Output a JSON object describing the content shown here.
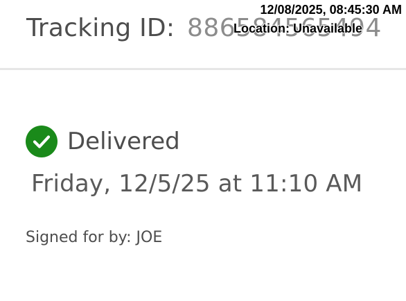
{
  "header": {
    "tracking_label": "Tracking ID:",
    "tracking_number": "886584565494"
  },
  "overlay": {
    "timestamp": "12/08/2025, 08:45:30 AM",
    "location": "Location: Unavailable"
  },
  "status": {
    "icon": "check-circle-icon",
    "icon_color": "#1a8a1a",
    "label": "Delivered",
    "date_time": "Friday, 12/5/25 at 11:10 AM",
    "signed_by": "Signed for by: JOE"
  }
}
